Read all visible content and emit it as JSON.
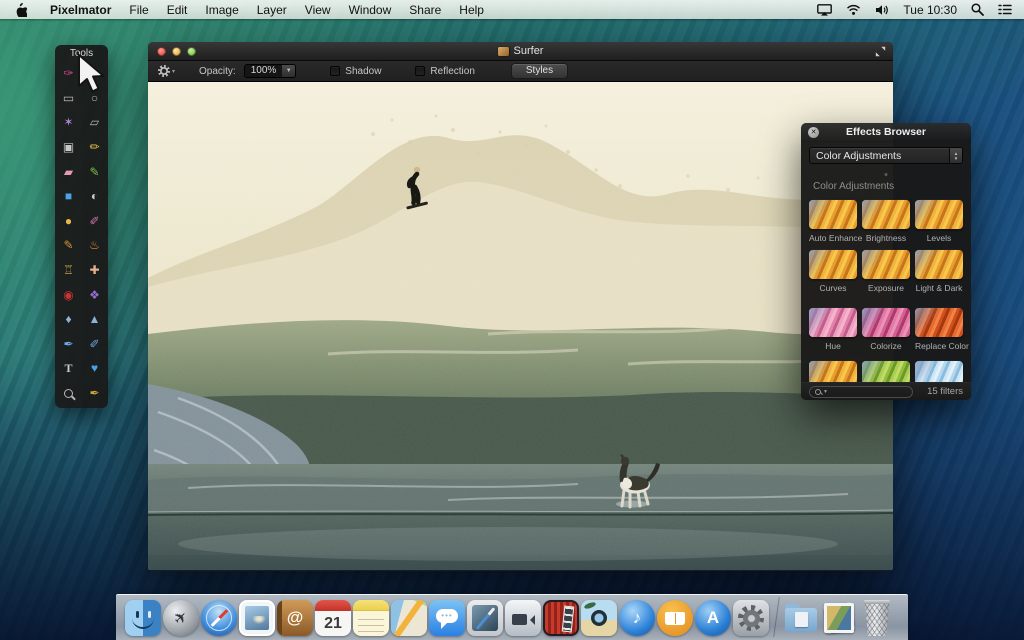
{
  "menu_bar": {
    "items": [
      "Pixelmator",
      "File",
      "Edit",
      "Image",
      "Layer",
      "View",
      "Window",
      "Share",
      "Help"
    ],
    "status_icons": [
      "airplay-icon",
      "wifi-icon",
      "volume-icon"
    ],
    "clock": "Tue 10:30"
  },
  "tools_palette": {
    "title": "Tools",
    "items": [
      {
        "n": "paint-selection-tool",
        "g": "✑"
      },
      {
        "n": "move-tool",
        "g": "➤"
      },
      {
        "n": "rectangular-marquee-tool",
        "g": "▭"
      },
      {
        "n": "elliptical-marquee-tool",
        "g": "○"
      },
      {
        "n": "magic-wand-tool",
        "g": "✶"
      },
      {
        "n": "lasso-tool",
        "g": "▱"
      },
      {
        "n": "crop-tool",
        "g": "▣"
      },
      {
        "n": "slice-tool",
        "g": "✏"
      },
      {
        "n": "eraser-tool",
        "g": "▰"
      },
      {
        "n": "pencil-tool",
        "g": "✎"
      },
      {
        "n": "paint-bucket-tool",
        "g": "■"
      },
      {
        "n": "gradient-tool",
        "g": "◐"
      },
      {
        "n": "shape-tool",
        "g": "●"
      },
      {
        "n": "brush-tool",
        "g": "✐"
      },
      {
        "n": "paintbrush-tool",
        "g": "✎"
      },
      {
        "n": "smudge-tool",
        "g": "♨"
      },
      {
        "n": "clone-stamp-tool",
        "g": "♖"
      },
      {
        "n": "healing-tool",
        "g": "✚"
      },
      {
        "n": "red-eye-tool",
        "g": "◉"
      },
      {
        "n": "sponge-tool",
        "g": "❖"
      },
      {
        "n": "blur-tool",
        "g": "♦"
      },
      {
        "n": "sharpen-tool",
        "g": "▲"
      },
      {
        "n": "pen-tool",
        "g": "✒"
      },
      {
        "n": "freeform-pen-tool",
        "g": "✐"
      },
      {
        "n": "type-tool",
        "g": "T"
      },
      {
        "n": "custom-shape-tool",
        "g": "♥"
      },
      {
        "n": "zoom-tool",
        "g": ""
      },
      {
        "n": "eyedropper-tool",
        "g": "✒"
      }
    ]
  },
  "window": {
    "title": "Surfer",
    "toolbar": {
      "opacity_label": "Opacity:",
      "opacity_value": "100%",
      "shadow_label": "Shadow",
      "reflection_label": "Reflection",
      "styles_label": "Styles"
    }
  },
  "effects_browser": {
    "title": "Effects Browser",
    "dropdown_value": "Color Adjustments",
    "section_title": "Color Adjustments",
    "items": [
      {
        "label": "Auto Enhance"
      },
      {
        "label": "Brightness"
      },
      {
        "label": "Levels"
      },
      {
        "label": "Curves"
      },
      {
        "label": "Exposure"
      },
      {
        "label": "Light & Dark"
      },
      {
        "label": "Hue"
      },
      {
        "label": "Colorize"
      },
      {
        "label": "Replace Color"
      }
    ],
    "partial_row_thumbs": 3,
    "footer_count": "15 filters"
  },
  "dock": {
    "calendar_day": "21",
    "icons": [
      "finder",
      "launchpad",
      "safari",
      "mail",
      "contacts",
      "calendar",
      "notes",
      "maps",
      "messages",
      "pixelmator",
      "facetime",
      "photo-booth",
      "iphoto",
      "itunes",
      "ibooks",
      "app-store",
      "system-preferences",
      "documents-folder",
      "photos-stack",
      "trash"
    ]
  },
  "colors": {
    "window_chrome": "#1d1d1d",
    "panel": "#191919",
    "menubar_tint": "#e8f0e8",
    "selection_blue": "#4aa3e8"
  }
}
